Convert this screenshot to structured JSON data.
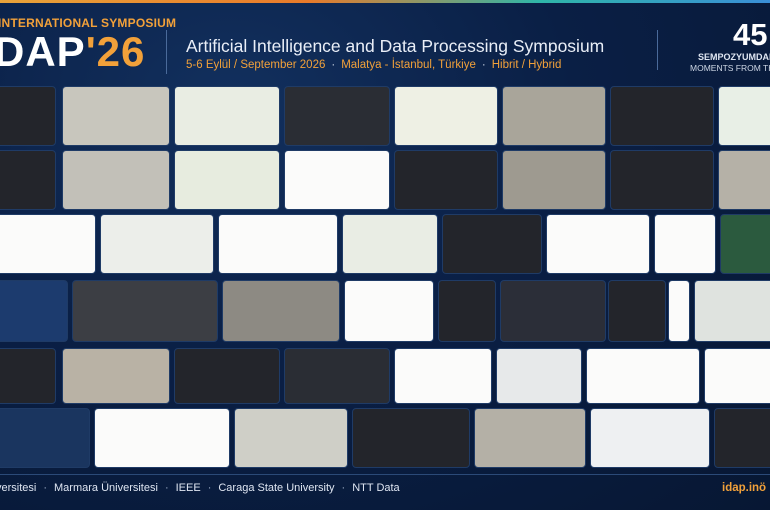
{
  "header": {
    "kicker": "INTERNATIONAL SYMPOSIUM",
    "logo_main": "DAP",
    "logo_accent": "'26",
    "title": "Artificial Intelligence and Data Processing Symposium",
    "subtitle": {
      "dates": "5-6 Eylül / September 2026",
      "location": "Malatya - İstanbul, Türkiye",
      "format": "Hibrit / Hybrid"
    }
  },
  "badge": {
    "number": "45",
    "line1": "SEMPOZYUMDAN",
    "line2": "MOMENTS FROM THE"
  },
  "footer": {
    "partners": [
      "versitesi",
      "Marmara Üniversitesi",
      "IEEE",
      "Caraga State University",
      "NTT Data"
    ],
    "url": "idap.inö"
  },
  "colors": {
    "accent": "#f2a13a",
    "background": "#0a1f45"
  }
}
